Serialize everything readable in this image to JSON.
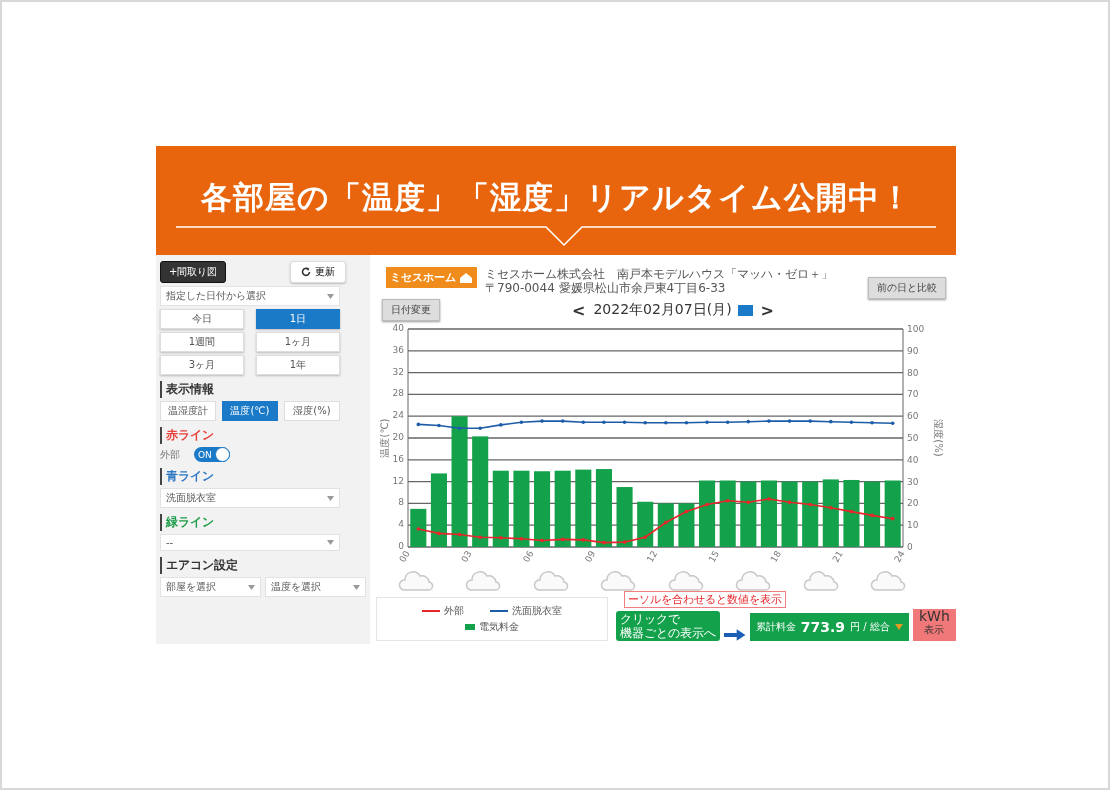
{
  "banner": {
    "headline": "各部屋の「温度」「湿度」リアルタイム公開中！"
  },
  "sidebar": {
    "floorplan_button": "+間取り図",
    "refresh_button": "更新",
    "date_select": "指定した日付から選択",
    "range_buttons": [
      {
        "label": "今日",
        "selected": false
      },
      {
        "label": "1日",
        "selected": true
      },
      {
        "label": "1週間",
        "selected": false
      },
      {
        "label": "1ヶ月",
        "selected": false
      },
      {
        "label": "3ヶ月",
        "selected": false
      },
      {
        "label": "1年",
        "selected": false
      }
    ],
    "display_heading": "表示情報",
    "display_tabs": [
      {
        "label": "温湿度計",
        "selected": false
      },
      {
        "label": "温度(℃)",
        "selected": true
      },
      {
        "label": "湿度(%)",
        "selected": false
      }
    ],
    "lines": [
      {
        "heading": "赤ライン",
        "color": "#e8413c",
        "kind": "toggle",
        "label": "外部",
        "toggle_text": "ON",
        "on": true
      },
      {
        "heading": "青ライン",
        "color": "#2f78c4",
        "kind": "select",
        "value": "洗面脱衣室"
      },
      {
        "heading": "緑ライン",
        "color": "#1e9e4a",
        "kind": "select",
        "value": "--"
      }
    ],
    "aircon_heading": "エアコン設定",
    "aircon_selects": [
      "部屋を選択",
      "温度を選択"
    ]
  },
  "header": {
    "logo": "ミセスホーム",
    "company": "ミセスホーム株式会社　南戸本モデルハウス「マッハ・ゼロ＋」",
    "address": "〒790-0044 愛媛県松山市余戸東4丁目6-33",
    "compare_button": "前の日と比較",
    "date_change_button": "日付変更",
    "prev": "<",
    "date": "2022年02月07日(月)",
    "next": ">"
  },
  "chart_data": {
    "type": "bar",
    "ylabel": "温度(℃)",
    "y2label": "湿度(%)",
    "grid": true,
    "xlim": [
      0,
      24
    ],
    "ylim": [
      0,
      40
    ],
    "y2lim": [
      0,
      100
    ],
    "x": [
      0.5,
      1.5,
      2.5,
      3.5,
      4.5,
      5.5,
      6.5,
      7.5,
      8.5,
      9.5,
      10.5,
      11.5,
      12.5,
      13.5,
      14.5,
      15.5,
      16.5,
      17.5,
      18.5,
      19.5,
      20.5,
      21.5,
      22.5,
      23.5
    ],
    "xticks": [
      {
        "value": 0,
        "label": "00"
      },
      {
        "value": 3,
        "label": "03"
      },
      {
        "value": 6,
        "label": "06"
      },
      {
        "value": 9,
        "label": "09"
      },
      {
        "value": 12,
        "label": "12"
      },
      {
        "value": 15,
        "label": "15"
      },
      {
        "value": 18,
        "label": "18"
      },
      {
        "value": 21,
        "label": "21"
      },
      {
        "value": 24,
        "label": "24"
      }
    ],
    "yticks": [
      0,
      4,
      8,
      12,
      16,
      20,
      24,
      28,
      32,
      36,
      40
    ],
    "y2ticks": [
      0,
      10,
      20,
      30,
      40,
      50,
      60,
      70,
      80,
      90,
      100
    ],
    "series": [
      {
        "name": "電気料金",
        "color": "#13a14b",
        "type": "bar",
        "values": [
          7,
          13.5,
          24,
          20.3,
          14,
          14,
          13.9,
          14,
          14.2,
          14.3,
          11,
          8.3,
          8,
          8,
          12.2,
          12.2,
          12,
          12.2,
          12,
          12,
          12.4,
          12.3,
          12,
          12.2
        ]
      },
      {
        "name": "外部",
        "color": "#e8262a",
        "type": "line",
        "values": [
          3.3,
          2.5,
          2.3,
          1.8,
          1.7,
          1.5,
          1.2,
          1.4,
          1.3,
          0.8,
          0.9,
          1.8,
          4.5,
          6.5,
          7.8,
          8.5,
          8.2,
          8.8,
          8.2,
          7.8,
          7.2,
          6.5,
          5.8,
          5.2
        ]
      },
      {
        "name": "洗面脱衣室",
        "color": "#1d5ca8",
        "type": "line",
        "values": [
          22.5,
          22.3,
          21.8,
          21.8,
          22.4,
          22.9,
          23.1,
          23.1,
          22.9,
          22.9,
          22.9,
          22.8,
          22.8,
          22.8,
          22.9,
          22.9,
          23.0,
          23.1,
          23.1,
          23.1,
          23.0,
          22.9,
          22.8,
          22.7
        ]
      }
    ]
  },
  "weather": [
    {
      "kind": "cloud"
    },
    {
      "kind": "cloud"
    },
    {
      "kind": "cloud"
    },
    {
      "kind": "cloud"
    },
    {
      "kind": "cloud"
    },
    {
      "kind": "cloud"
    },
    {
      "kind": "cloud"
    },
    {
      "kind": "cloud"
    }
  ],
  "footer": {
    "hint": "ーソルを合わせると数値を表示",
    "device_button": [
      "クリックで",
      "機器ごとの表示へ"
    ],
    "total_label": "累計料金",
    "total_value": "773.9",
    "total_unit": "円 / 総合",
    "kwh_button": "kWh",
    "kwh_sub": "表示"
  }
}
